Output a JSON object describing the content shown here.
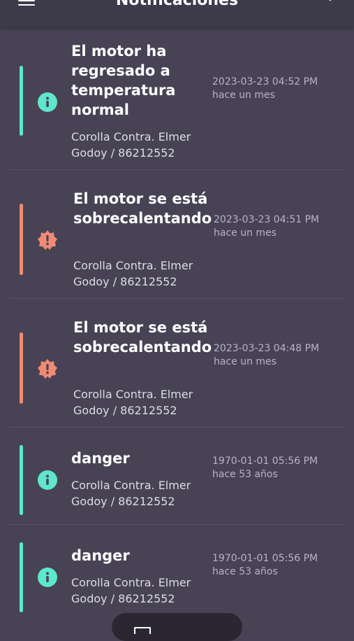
{
  "header": {
    "title": "Notificaciones",
    "menu_icon": "menu-icon",
    "back_icon": "arrow-left-icon"
  },
  "colors": {
    "info": "#5ee6cf",
    "warning": "#f08a74",
    "background": "#474354"
  },
  "notifications": [
    {
      "severity": "info",
      "icon": "info-icon",
      "message": "El motor ha regresado a temperatura normal",
      "vehicle": "Corolla Contra. Elmer Godoy / 86212552",
      "time": "2023-03-23 04:52 PM hace un mes"
    },
    {
      "severity": "warning",
      "icon": "alert-badge-icon",
      "message": "El motor se está sobrecalentando",
      "vehicle": "Corolla Contra. Elmer Godoy / 86212552",
      "time": "2023-03-23 04:51 PM hace un mes"
    },
    {
      "severity": "warning",
      "icon": "alert-badge-icon",
      "message": "El motor se está sobrecalentando",
      "vehicle": "Corolla Contra. Elmer Godoy / 86212552",
      "time": "2023-03-23 04:48 PM hace un mes"
    },
    {
      "severity": "info",
      "icon": "info-icon",
      "message": "danger",
      "vehicle": "Corolla Contra. Elmer Godoy / 86212552",
      "time": "1970-01-01 05:56 PM hace 53 años"
    },
    {
      "severity": "info",
      "icon": "info-icon",
      "message": "danger",
      "vehicle": "Corolla Contra. Elmer Godoy / 86212552",
      "time": "1970-01-01 05:56 PM hace 53 años"
    }
  ]
}
